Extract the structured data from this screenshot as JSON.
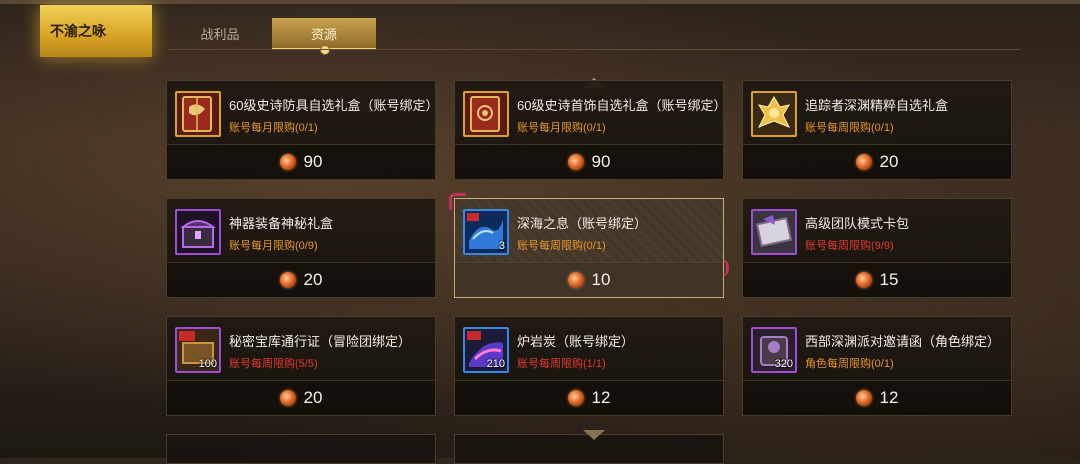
{
  "header": {
    "title": "不渝之咏"
  },
  "tabs": [
    {
      "label": "战利品",
      "active": false
    },
    {
      "label": "资源",
      "active": true
    }
  ],
  "colors": {
    "accent_gold": "#d9a826",
    "limit_orange": "#e6972b",
    "limit_red": "#e23b2f"
  },
  "items": [
    {
      "name": "60级史诗防具自选礼盒（账号绑定）",
      "limit": "账号每月限购(0/1)",
      "price": "90",
      "icon": "red-book-gift-icon"
    },
    {
      "name": "60级史诗首饰自选礼盒（账号绑定）",
      "limit": "账号每月限购(0/1)",
      "price": "90",
      "icon": "red-book-gift-icon"
    },
    {
      "name": "追踪者深渊精粹自选礼盒",
      "limit": "账号每周限购(0/1)",
      "price": "20",
      "icon": "golden-crystal-icon"
    },
    {
      "name": "神器装备神秘礼盒",
      "limit": "账号每月限购(0/9)",
      "price": "20",
      "icon": "purple-chest-icon"
    },
    {
      "name": "深海之息（账号绑定）",
      "limit": "账号每周限购(0/1)",
      "price": "10",
      "icon": "blue-wave-icon",
      "count": "3"
    },
    {
      "name": "高级团队模式卡包",
      "limit": "账号每周限购(9/9)",
      "price": "15",
      "icon": "card-pack-icon"
    },
    {
      "name": "秘密宝库通行证（冒险团绑定）",
      "limit": "账号每周限购(5/5)",
      "price": "20",
      "icon": "vault-pass-icon",
      "count": "100"
    },
    {
      "name": "炉岩炭（账号绑定）",
      "limit": "账号每周限购(1/1)",
      "price": "12",
      "icon": "furnace-coal-icon",
      "count": "210"
    },
    {
      "name": "西部深渊派对邀请函（角色绑定）",
      "limit": "角色每周限购(0/1)",
      "price": "12",
      "icon": "invitation-icon",
      "count": "320"
    }
  ]
}
